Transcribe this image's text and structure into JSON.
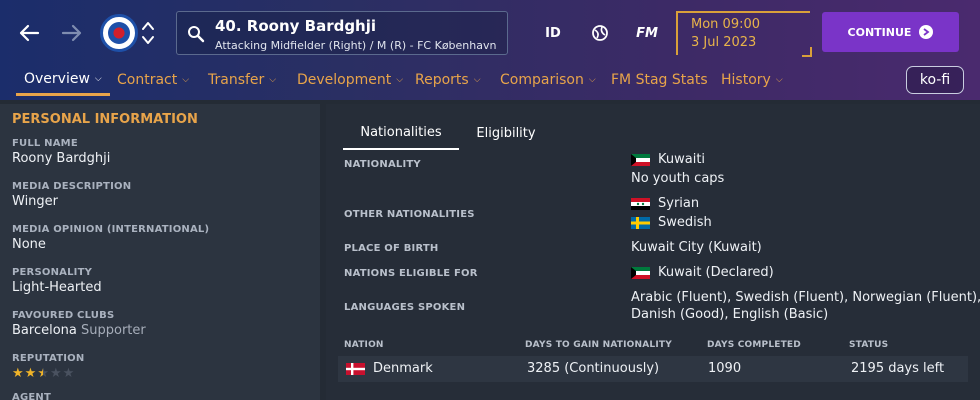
{
  "header": {
    "player_title": "40. Roony Bardghji",
    "player_subtitle": "Attacking Midfielder (Right) / M (R) - FC København",
    "btn_id": "ID",
    "btn_fm": "FM",
    "date_time": "Mon 09:00",
    "date_day": "3 Jul 2023",
    "continue_label": "CONTINUE",
    "kofi_label": "ko-fi"
  },
  "tabs": [
    {
      "label": "Overview"
    },
    {
      "label": "Contract"
    },
    {
      "label": "Transfer"
    },
    {
      "label": "Development"
    },
    {
      "label": "Reports"
    },
    {
      "label": "Comparison"
    },
    {
      "label": "FM Stag Stats"
    },
    {
      "label": "History"
    }
  ],
  "personal": {
    "title": "PERSONAL INFORMATION",
    "rows": [
      {
        "label": "FULL NAME",
        "value": "Roony Bardghji"
      },
      {
        "label": "MEDIA DESCRIPTION",
        "value": "Winger"
      },
      {
        "label": "MEDIA OPINION (INTERNATIONAL)",
        "value": "None"
      },
      {
        "label": "PERSONALITY",
        "value": "Light-Hearted"
      },
      {
        "label": "FAVOURED CLUBS",
        "value": "Barcelona",
        "suffix": "Supporter"
      },
      {
        "label": "REPUTATION",
        "stars": 2.5,
        "stars_max": 5
      },
      {
        "label": "AGENT"
      }
    ]
  },
  "nationality_tabs": {
    "nationalities": "Nationalities",
    "eligibility": "Eligibility"
  },
  "nationality": {
    "nationality_label": "NATIONALITY",
    "nationality_value": "Kuwaiti",
    "youth_caps": "No youth caps",
    "other_label": "OTHER NATIONALITIES",
    "other_1": "Syrian",
    "other_2": "Swedish",
    "birth_label": "PLACE OF BIRTH",
    "birth_value": "Kuwait City (Kuwait)",
    "eligible_label": "NATIONS ELIGIBLE FOR",
    "eligible_value": "Kuwait (Declared)",
    "languages_label": "LANGUAGES SPOKEN",
    "languages_line1": "Arabic (Fluent), Swedish (Fluent), Norwegian (Fluent),",
    "languages_line2": "Danish (Good), English (Basic)"
  },
  "table": {
    "headers": [
      "NATION",
      "DAYS TO GAIN NATIONALITY",
      "DAYS COMPLETED",
      "STATUS"
    ],
    "rows": [
      {
        "nation": "Denmark",
        "days_to_gain": "3285 (Continuously)",
        "days_completed": "1090",
        "status": "2195 days left"
      }
    ]
  },
  "colors": {
    "accent_orange": "#e8a44a",
    "continue_purple": "#7a34c8",
    "star_gold": "#f0b429"
  }
}
